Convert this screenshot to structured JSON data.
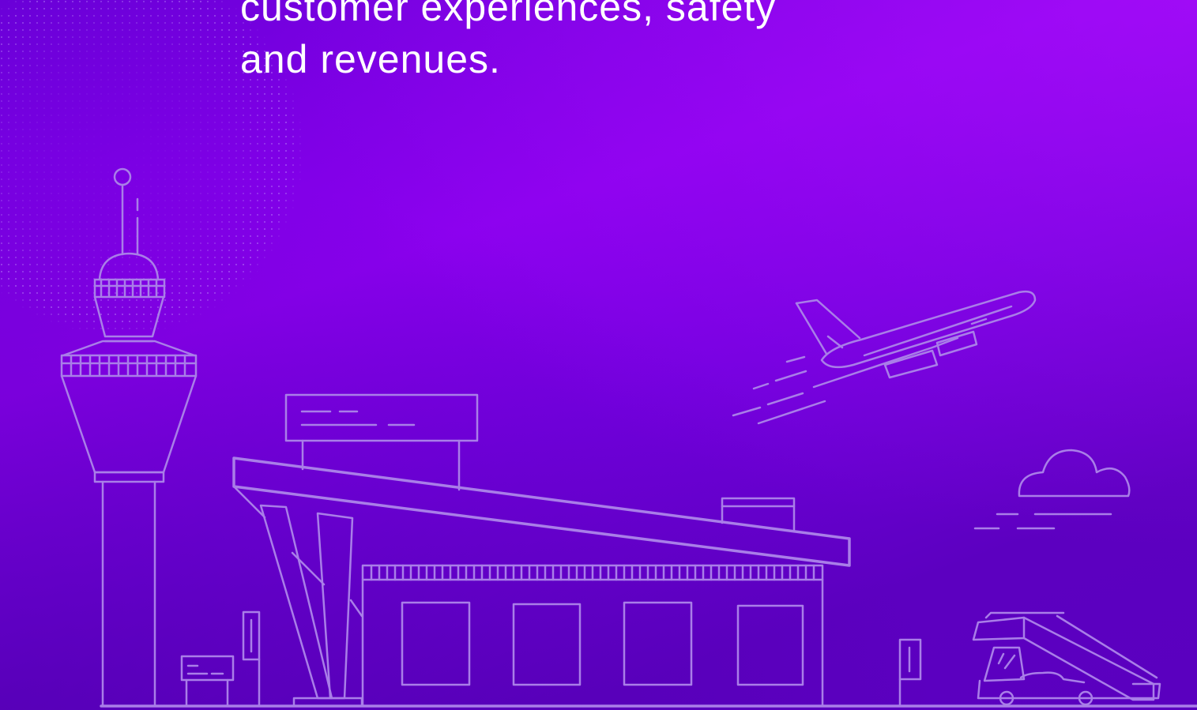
{
  "hero": {
    "headline_line_1": "customer experiences, safety",
    "headline_line_2": "and revenues."
  },
  "colors": {
    "background_start": "#6a00d8",
    "background_end": "#5a00bf",
    "accent_glow": "#b414ff",
    "line_art": "#a97ee8",
    "text": "#ffffff"
  },
  "illustration": {
    "elements": [
      "control-tower",
      "terminal-building",
      "airplane-taking-off",
      "cloud",
      "boarding-stairs-truck",
      "dotted-sphere"
    ]
  }
}
